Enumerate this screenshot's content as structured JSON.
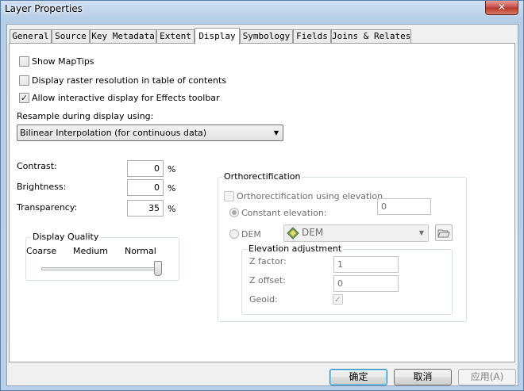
{
  "window": {
    "title": "Layer Properties",
    "close_glyph": "✕"
  },
  "tabs": [
    {
      "label": "General"
    },
    {
      "label": "Source"
    },
    {
      "label": "Key Metadata"
    },
    {
      "label": "Extent"
    },
    {
      "label": "Display",
      "active": true
    },
    {
      "label": "Symbology"
    },
    {
      "label": "Fields"
    },
    {
      "label": "Joins & Relates"
    }
  ],
  "display": {
    "show_maptips": {
      "label": "Show MapTips",
      "checked": false
    },
    "raster_resolution": {
      "label": "Display raster resolution in table of contents",
      "checked": false
    },
    "interactive_effects": {
      "label": "Allow interactive display for Effects toolbar",
      "checked": true
    },
    "resample_label": "Resample during display using:",
    "resample_value": "Bilinear Interpolation (for continuous data)",
    "contrast": {
      "label": "Contrast:",
      "value": "0",
      "unit": "%"
    },
    "brightness": {
      "label": "Brightness:",
      "value": "0",
      "unit": "%"
    },
    "transparency": {
      "label": "Transparency:",
      "value": "35",
      "unit": "%"
    },
    "quality": {
      "title": "Display Quality",
      "coarse": "Coarse",
      "medium": "Medium",
      "normal": "Normal",
      "level": 1.0
    }
  },
  "ortho": {
    "title": "Orthorectification",
    "using_elevation": {
      "label": "Orthorectification using elevation",
      "checked": false
    },
    "constant": {
      "label": "Constant elevation:",
      "value": "0",
      "selected": true
    },
    "dem": {
      "label": "DEM",
      "value": "DEM",
      "selected": false
    },
    "adjust": {
      "title": "Elevation adjustment",
      "z_factor": {
        "label": "Z factor:",
        "value": "1"
      },
      "z_offset": {
        "label": "Z offset:",
        "value": "0"
      },
      "geoid": {
        "label": "Geoid:",
        "checked": true
      }
    }
  },
  "buttons": {
    "ok": "确定",
    "cancel": "取消",
    "apply": "应用(A)"
  },
  "glyphs": {
    "check": "✓",
    "down": "▼"
  },
  "colors": {
    "title_bg": "#b9d1ea",
    "close": "#c75050",
    "default_btn": "#3c7fb1"
  }
}
